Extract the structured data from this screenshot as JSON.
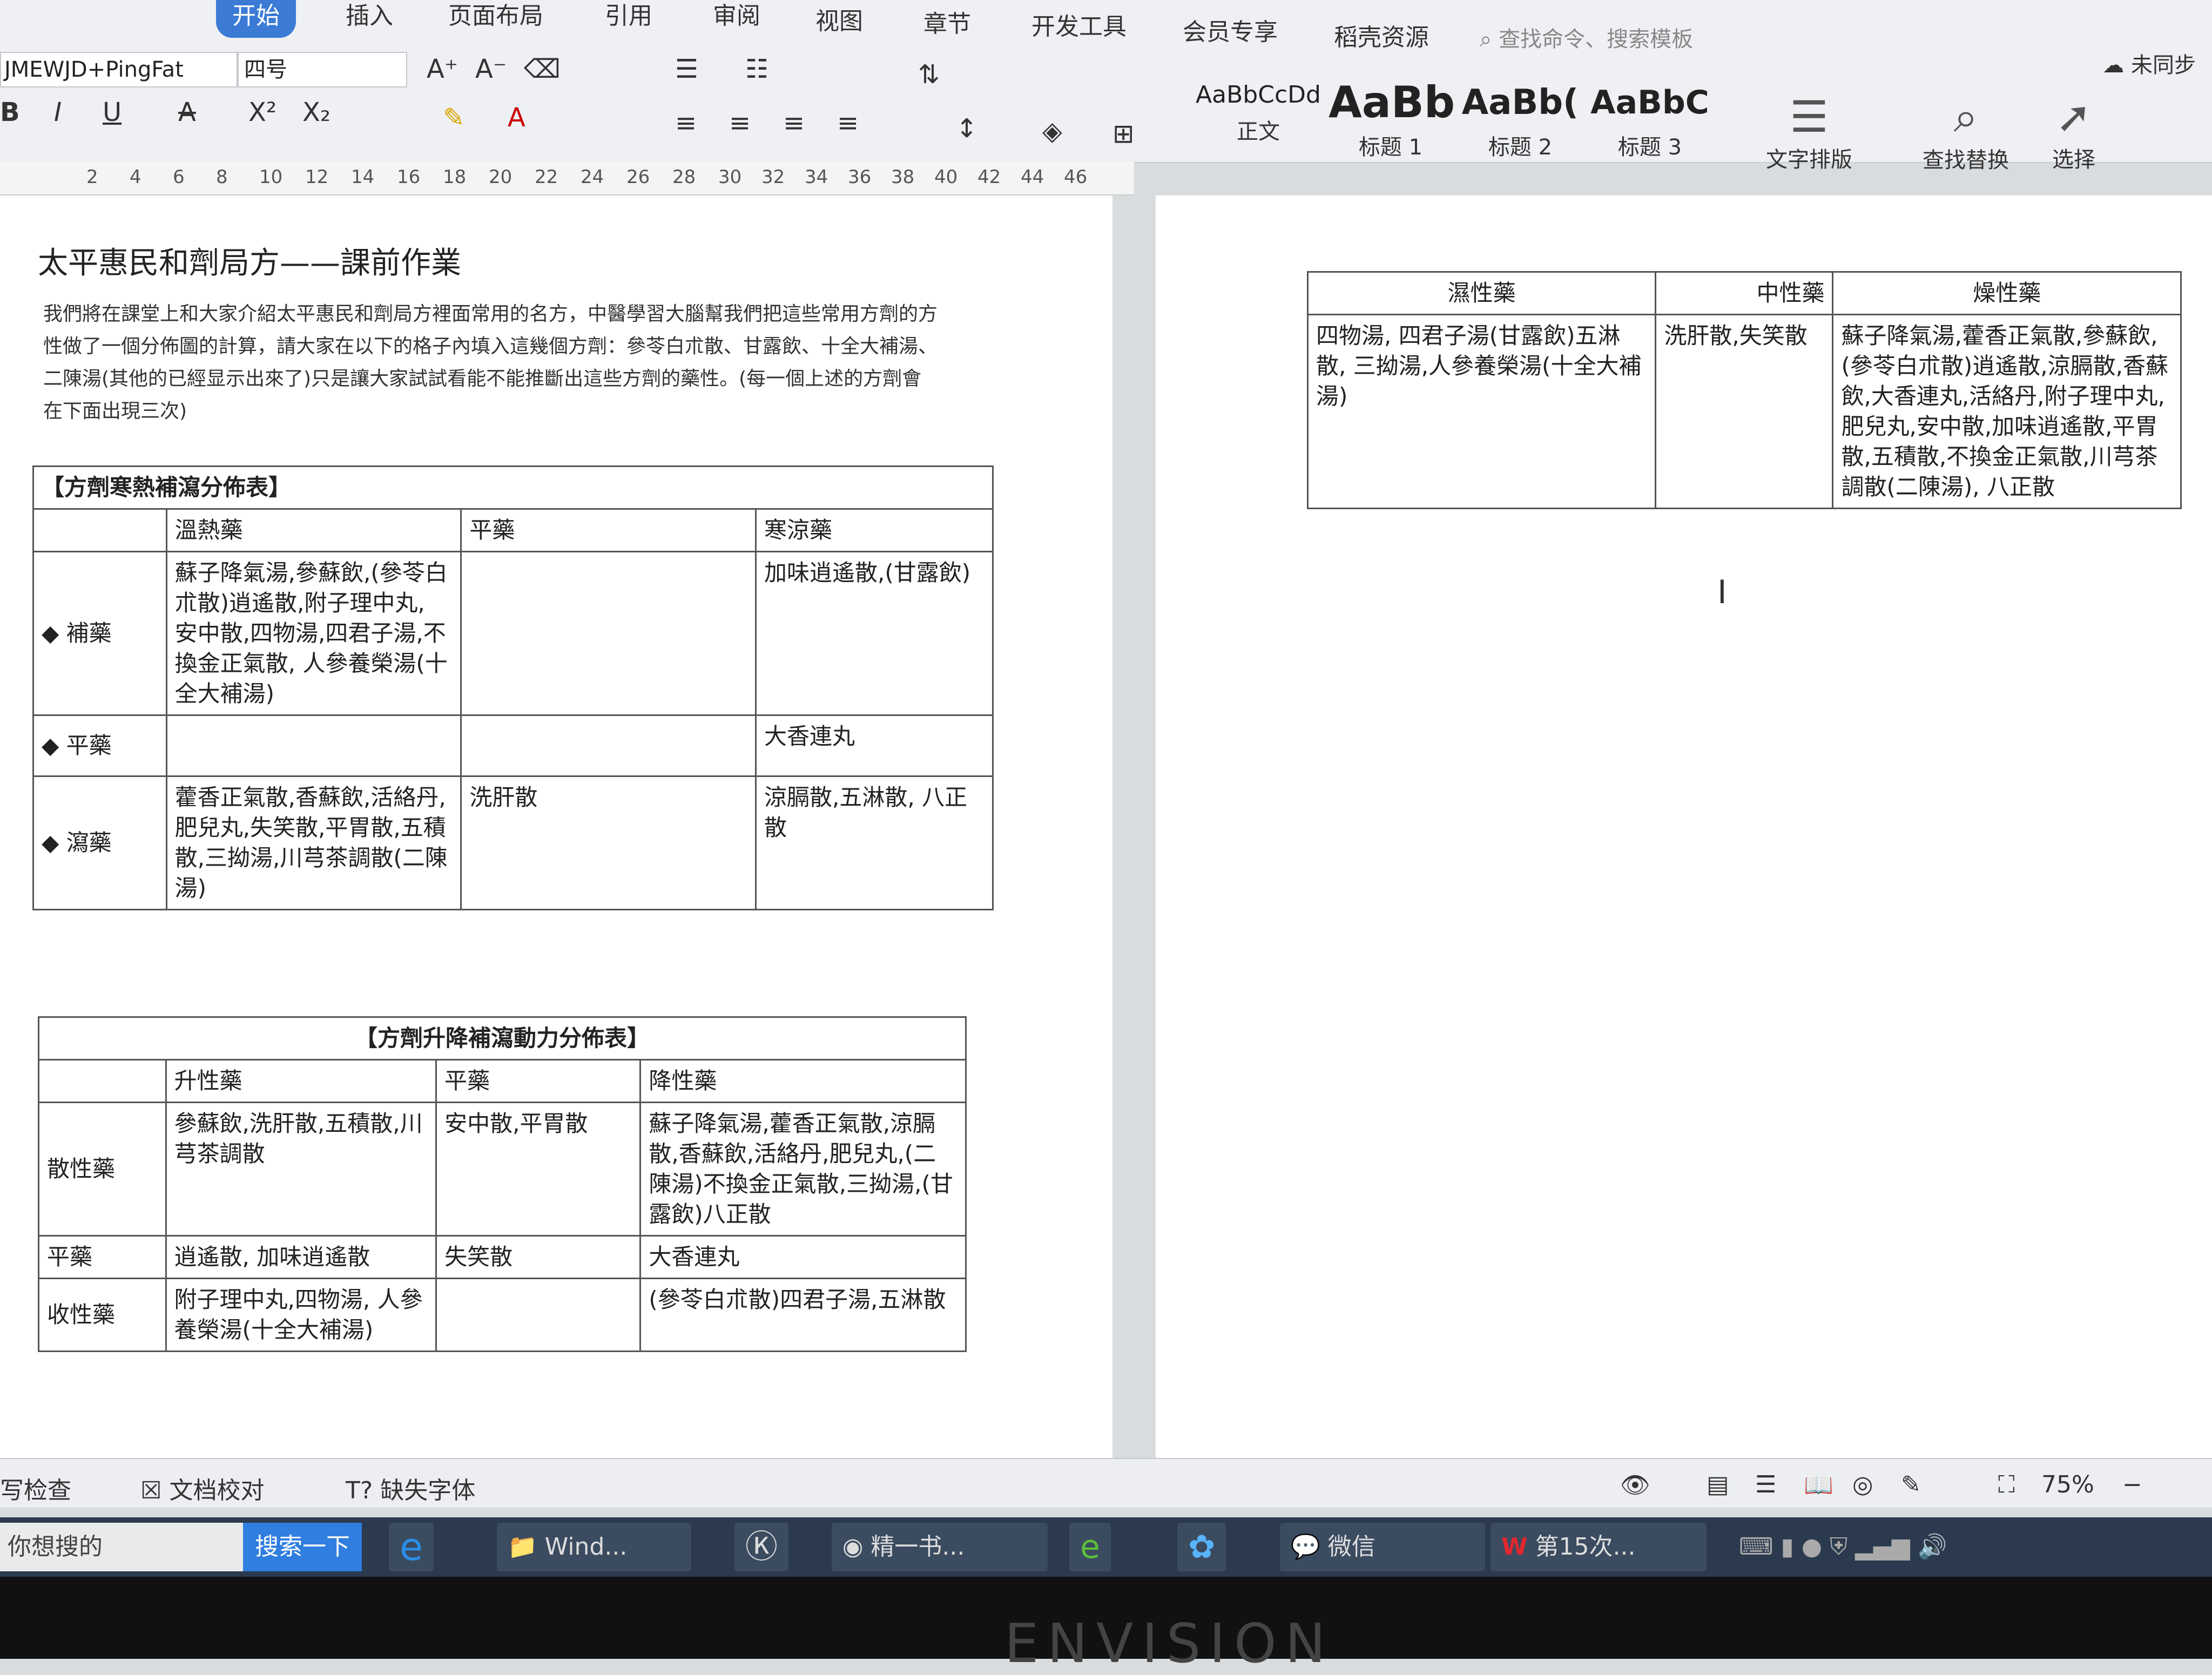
{
  "menu": {
    "tabs": [
      "开始",
      "插入",
      "页面布局",
      "引用",
      "审阅",
      "视图",
      "章节",
      "开发工具",
      "会员专享",
      "稻壳资源"
    ],
    "search_placeholder": "查找命令、搜索模板",
    "sync_status": "未同步"
  },
  "font": {
    "name": "JMEWJD+PingFat",
    "size": "四号"
  },
  "styles": [
    {
      "sample": "AaBbCcDd",
      "label": "正文"
    },
    {
      "sample": "AaBb",
      "label": "标题 1"
    },
    {
      "sample": "AaBb(",
      "label": "标题 2"
    },
    {
      "sample": "AaBbC",
      "label": "标题 3"
    }
  ],
  "tools": {
    "typeset": "文字排版",
    "find_replace": "查找替换",
    "select": "选择"
  },
  "ruler_numbers": [
    "2",
    "4",
    "6",
    "8",
    "10",
    "12",
    "14",
    "16",
    "18",
    "20",
    "22",
    "24",
    "26",
    "28",
    "30",
    "32",
    "34",
    "36",
    "38",
    "40",
    "42",
    "44",
    "46"
  ],
  "document": {
    "title": "太平惠民和劑局方——課前作業",
    "intro": "我們將在課堂上和大家介紹太平惠民和劑局方裡面常用的名方，中醫學習大腦幫我們把這些常用方劑的方性做了一個分佈圖的計算，請大家在以下的格子內填入這幾個方劑：參苓白朮散、甘露飲、十全大補湯、二陳湯(其他的已經显示出來了)只是讓大家試試看能不能推斷出這些方劑的藥性。(每一個上述的方劑會在下面出現三次)",
    "table1": {
      "caption": "【方劑寒熱補瀉分佈表】",
      "headers": [
        "",
        "溫熱藥",
        "平藥",
        "寒涼藥"
      ],
      "rows": [
        {
          "label": "◆ 補藥",
          "cells": [
            "蘇子降氣湯,參蘇飲,(參苓白朮散)逍遙散,附子理中丸, 安中散,四物湯,四君子湯,不換金正氣散, 人參養榮湯(十全大補湯)",
            "",
            "加味逍遙散,(甘露飲)"
          ]
        },
        {
          "label": "◆ 平藥",
          "cells": [
            "",
            "",
            "大香連丸"
          ]
        },
        {
          "label": "◆ 瀉藥",
          "cells": [
            "藿香正氣散,香蘇飲,活絡丹,肥兒丸,失笑散,平胃散,五積散,三拗湯,川芎茶調散(二陳湯)",
            "洗肝散",
            "涼膈散,五淋散, 八正散"
          ]
        }
      ]
    },
    "table2": {
      "caption": "【方劑升降補瀉動力分佈表】",
      "headers": [
        "",
        "升性藥",
        "平藥",
        "降性藥"
      ],
      "rows": [
        {
          "label": "散性藥",
          "cells": [
            "參蘇飲,洗肝散,五積散,川芎茶調散",
            "安中散,平胃散",
            "蘇子降氣湯,藿香正氣散,涼膈散,香蘇飲,活絡丹,肥兒丸,(二陳湯)不換金正氣散,三拗湯,(甘露飲)八正散"
          ]
        },
        {
          "label": "平藥",
          "cells": [
            "逍遙散, 加味逍遙散",
            "失笑散",
            "大香連丸"
          ]
        },
        {
          "label": "收性藥",
          "cells": [
            "附子理中丸,四物湯, 人參養榮湯(十全大補湯)",
            "",
            "(參苓白朮散)四君子湯,五淋散"
          ]
        }
      ]
    },
    "table3": {
      "headers": [
        "濕性藥",
        "中性藥",
        "燥性藥"
      ],
      "cells": [
        "四物湯, 四君子湯(甘露飲)五淋散, 三拗湯,人參養榮湯(十全大補湯)",
        "洗肝散,失笑散",
        "蘇子降氣湯,藿香正氣散,參蘇飲,(參苓白朮散)逍遙散,涼膈散,香蘇飲,大香連丸,活絡丹,附子理中丸,肥兒丸,安中散,加味逍遙散,平胃散,五積散,不換金正氣散,川芎茶調散(二陳湯), 八正散"
      ]
    }
  },
  "status": {
    "spell": "写检查",
    "proof": "文档校对",
    "missing_font": "缺失字体",
    "zoom": "75%"
  },
  "taskbar": {
    "search_placeholder": "你想搜的",
    "search_button": "搜索一下",
    "apps": [
      "Wind...",
      "精一书...",
      "微信",
      "第15次..."
    ]
  },
  "brand": "ENVISION"
}
